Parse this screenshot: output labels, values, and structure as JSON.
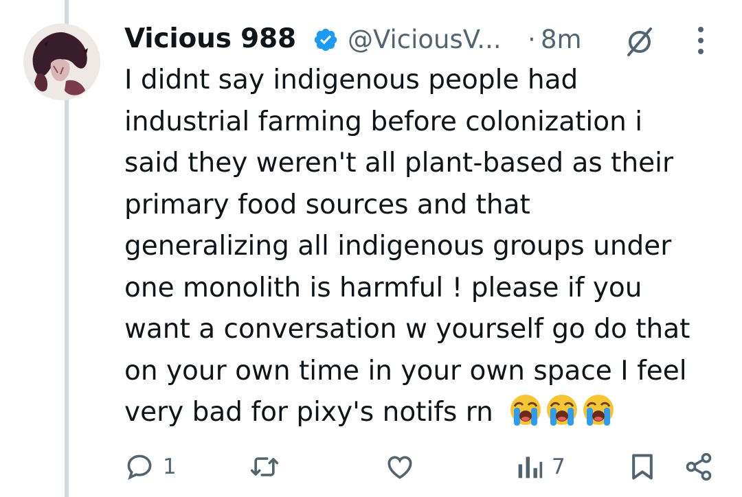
{
  "tweet": {
    "author_name": "Vicious 988",
    "handle": "@ViciousV...",
    "separator": "·",
    "time": "8m",
    "body_lines": [
      "I didnt say indigenous people had",
      "industrial farming before colonization i",
      "said they weren't all plant-based as their",
      "primary food sources and that",
      "generalizing all indigenous groups under",
      "one monolith is harmful ! please if you",
      "want a conversation w yourself go do that",
      "on your own time in your own space I feel",
      "very bad for pixy's notifs rn"
    ],
    "emojis": [
      "loudly-crying-face",
      "loudly-crying-face",
      "loudly-crying-face"
    ]
  },
  "actions": {
    "reply_count": "1",
    "repost_count": "",
    "like_count": "",
    "views_count": "7"
  },
  "colors": {
    "text": "#0f1419",
    "muted": "#536471",
    "verified": "#1d9bf0",
    "thread_line": "#cfd9de"
  },
  "icons": [
    "verified-badge-icon",
    "grok-icon",
    "more-icon",
    "reply-icon",
    "repost-icon",
    "like-icon",
    "views-icon",
    "bookmark-icon",
    "share-icon"
  ]
}
